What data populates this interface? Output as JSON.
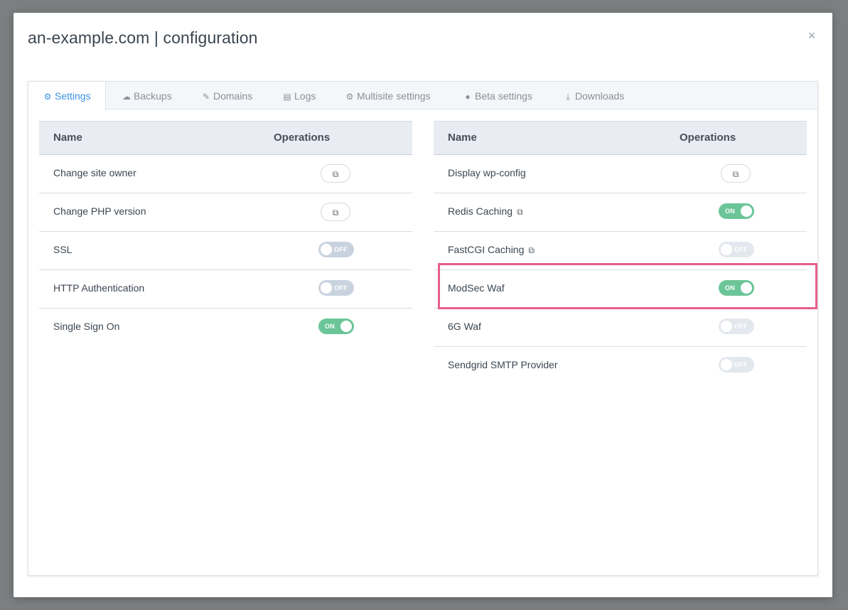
{
  "modal": {
    "title": "an-example.com | configuration",
    "close_icon": "×"
  },
  "tabs": [
    {
      "label": "Settings",
      "icon": "gear-icon",
      "glyph": "⚙",
      "active": true
    },
    {
      "label": "Backups",
      "icon": "cloud-icon",
      "glyph": "☁",
      "active": false
    },
    {
      "label": "Domains",
      "icon": "edit-icon",
      "glyph": "✎",
      "active": false
    },
    {
      "label": "Logs",
      "icon": "file-icon",
      "glyph": "▤",
      "active": false
    },
    {
      "label": "Multisite settings",
      "icon": "gear-icon",
      "glyph": "⚙",
      "active": false
    },
    {
      "label": "Beta settings",
      "icon": "alert-circle-icon",
      "glyph": "●",
      "active": false
    },
    {
      "label": "Downloads",
      "icon": "download-icon",
      "glyph": "⤓",
      "active": false
    }
  ],
  "left_table": {
    "headers": {
      "name": "Name",
      "operations": "Operations"
    },
    "rows": [
      {
        "name": "Change site owner",
        "op": "link",
        "glyph": "⧉"
      },
      {
        "name": "Change PHP version",
        "op": "link",
        "glyph": "⧉"
      },
      {
        "name": "SSL",
        "op": "toggle",
        "state": "OFF"
      },
      {
        "name": "HTTP Authentication",
        "op": "toggle",
        "state": "OFF"
      },
      {
        "name": "Single Sign On",
        "op": "toggle",
        "state": "ON"
      }
    ]
  },
  "right_table": {
    "headers": {
      "name": "Name",
      "operations": "Operations"
    },
    "rows": [
      {
        "name": "Display wp-config",
        "op": "link",
        "glyph": "⧉"
      },
      {
        "name": "Redis Caching",
        "external": "⧉",
        "op": "toggle",
        "state": "ON"
      },
      {
        "name": "FastCGI Caching",
        "external": "⧉",
        "op": "toggle",
        "state": "OFF"
      },
      {
        "name": "ModSec Waf",
        "op": "toggle",
        "state": "ON"
      },
      {
        "name": "6G Waf",
        "op": "toggle",
        "state": "OFF"
      },
      {
        "name": "Sendgrid SMTP Provider",
        "op": "toggle",
        "state": "OFF"
      }
    ]
  },
  "colors": {
    "accent": "#3c91e6",
    "toggle_on": "#6cc598",
    "toggle_off": "#c9d3df",
    "highlight": "#e85d8e"
  }
}
